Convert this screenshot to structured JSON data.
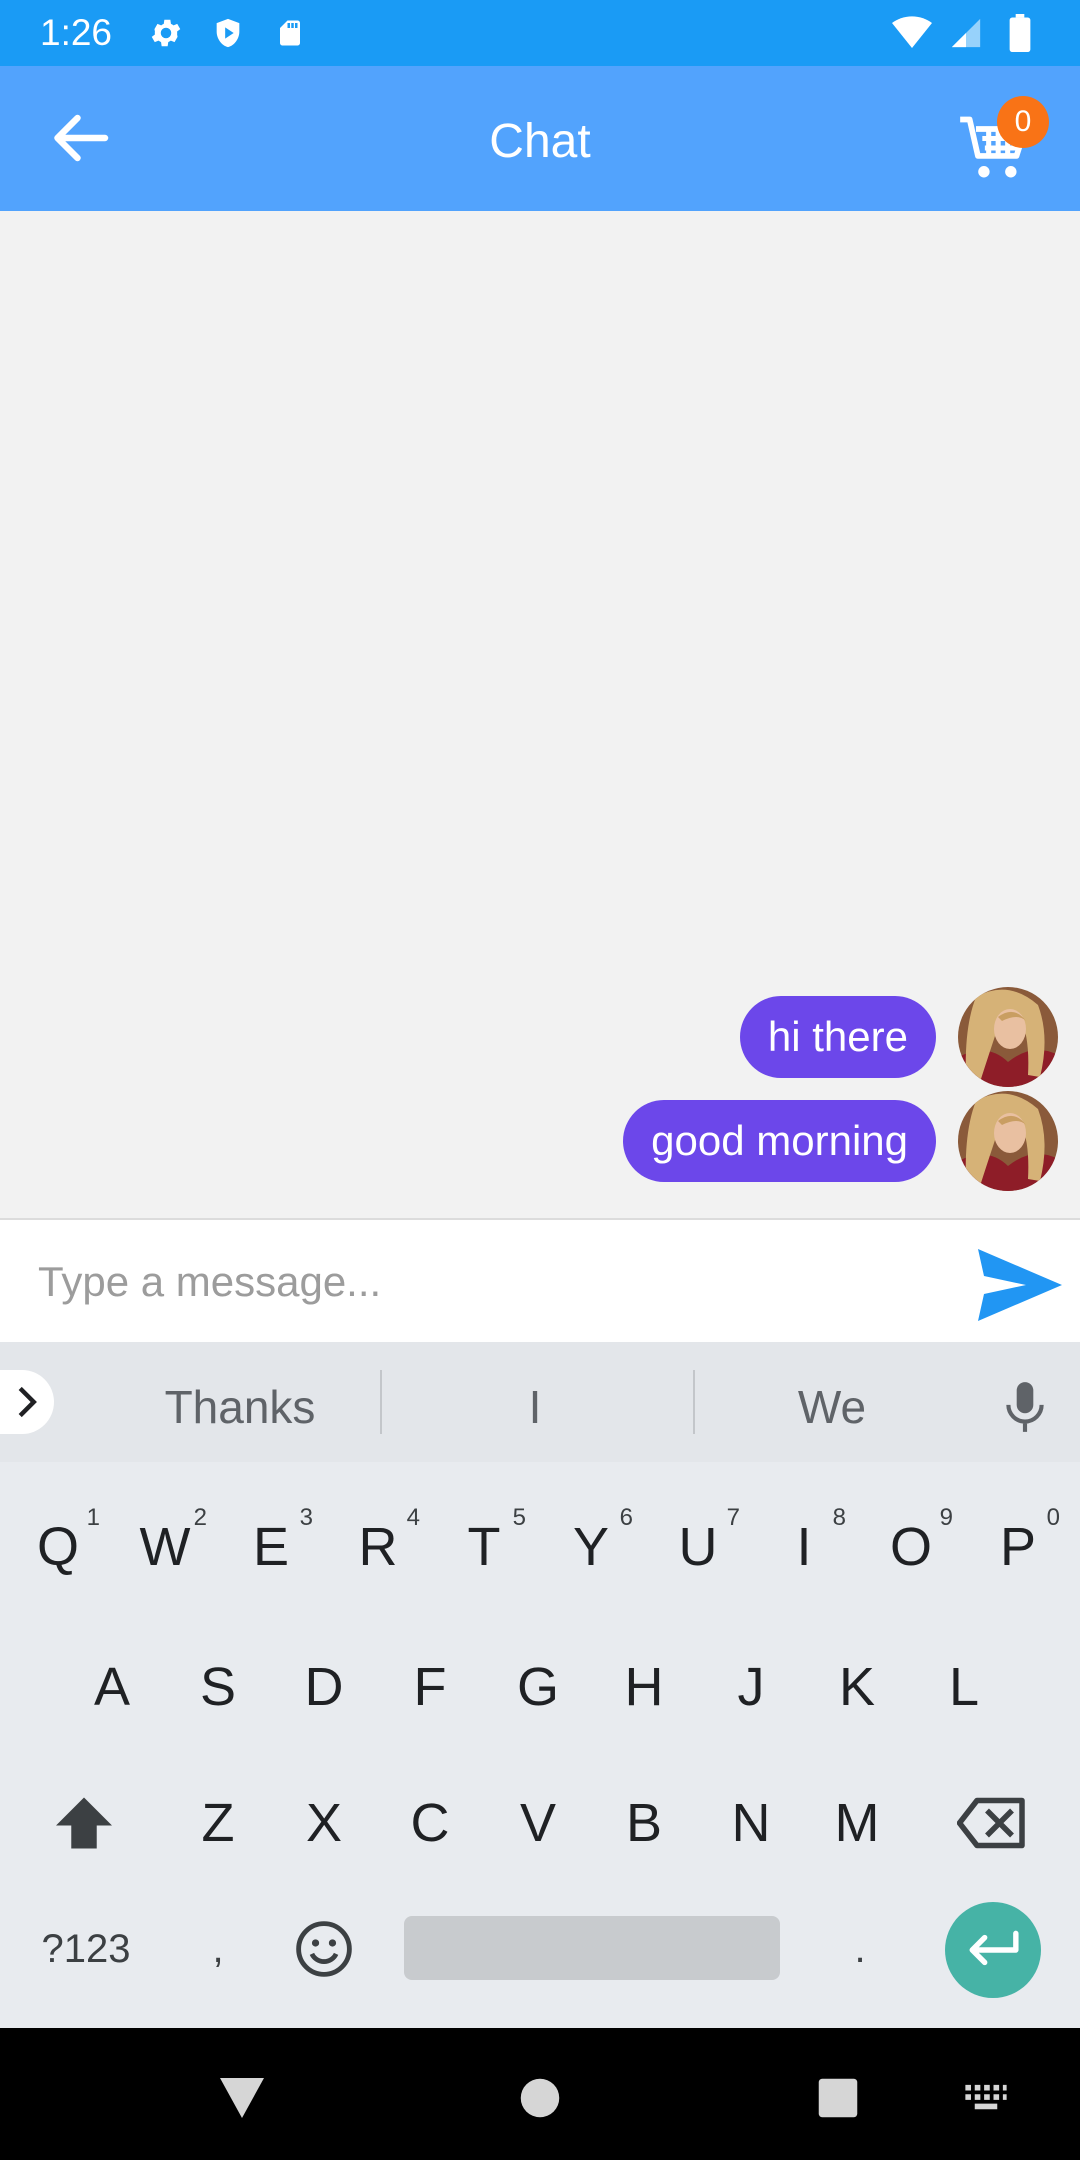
{
  "status_bar": {
    "time": "1:26",
    "left_icons": [
      "gear-icon",
      "shield-icon",
      "sd-card-icon"
    ],
    "right_icons": [
      "wifi-icon",
      "signal-icon",
      "battery-icon"
    ]
  },
  "app_bar": {
    "title": "Chat",
    "back_icon": "arrow-left-icon",
    "cart_icon": "cart-icon",
    "cart_count": "0",
    "color": "#52a3fd"
  },
  "messages": [
    {
      "text": "hi there",
      "sender": "me"
    },
    {
      "text": "good morning",
      "sender": "me"
    }
  ],
  "composer": {
    "placeholder": "Type a message...",
    "value": "",
    "send_icon": "send-icon"
  },
  "keyboard": {
    "suggestions": [
      "Thanks",
      "I",
      "We"
    ],
    "row1": [
      {
        "key": "Q",
        "hint": "1"
      },
      {
        "key": "W",
        "hint": "2"
      },
      {
        "key": "E",
        "hint": "3"
      },
      {
        "key": "R",
        "hint": "4"
      },
      {
        "key": "T",
        "hint": "5"
      },
      {
        "key": "Y",
        "hint": "6"
      },
      {
        "key": "U",
        "hint": "7"
      },
      {
        "key": "I",
        "hint": "8"
      },
      {
        "key": "O",
        "hint": "9"
      },
      {
        "key": "P",
        "hint": "0"
      }
    ],
    "row2": [
      "A",
      "S",
      "D",
      "F",
      "G",
      "H",
      "J",
      "K",
      "L"
    ],
    "row3": [
      "Z",
      "X",
      "C",
      "V",
      "B",
      "N",
      "M"
    ],
    "symbols_label": "?123",
    "comma": ",",
    "period": "."
  },
  "colors": {
    "status_bar": "#1a9bf5",
    "bubble": "#6c47ea",
    "send": "#2196f3",
    "enter": "#46b3a6"
  }
}
